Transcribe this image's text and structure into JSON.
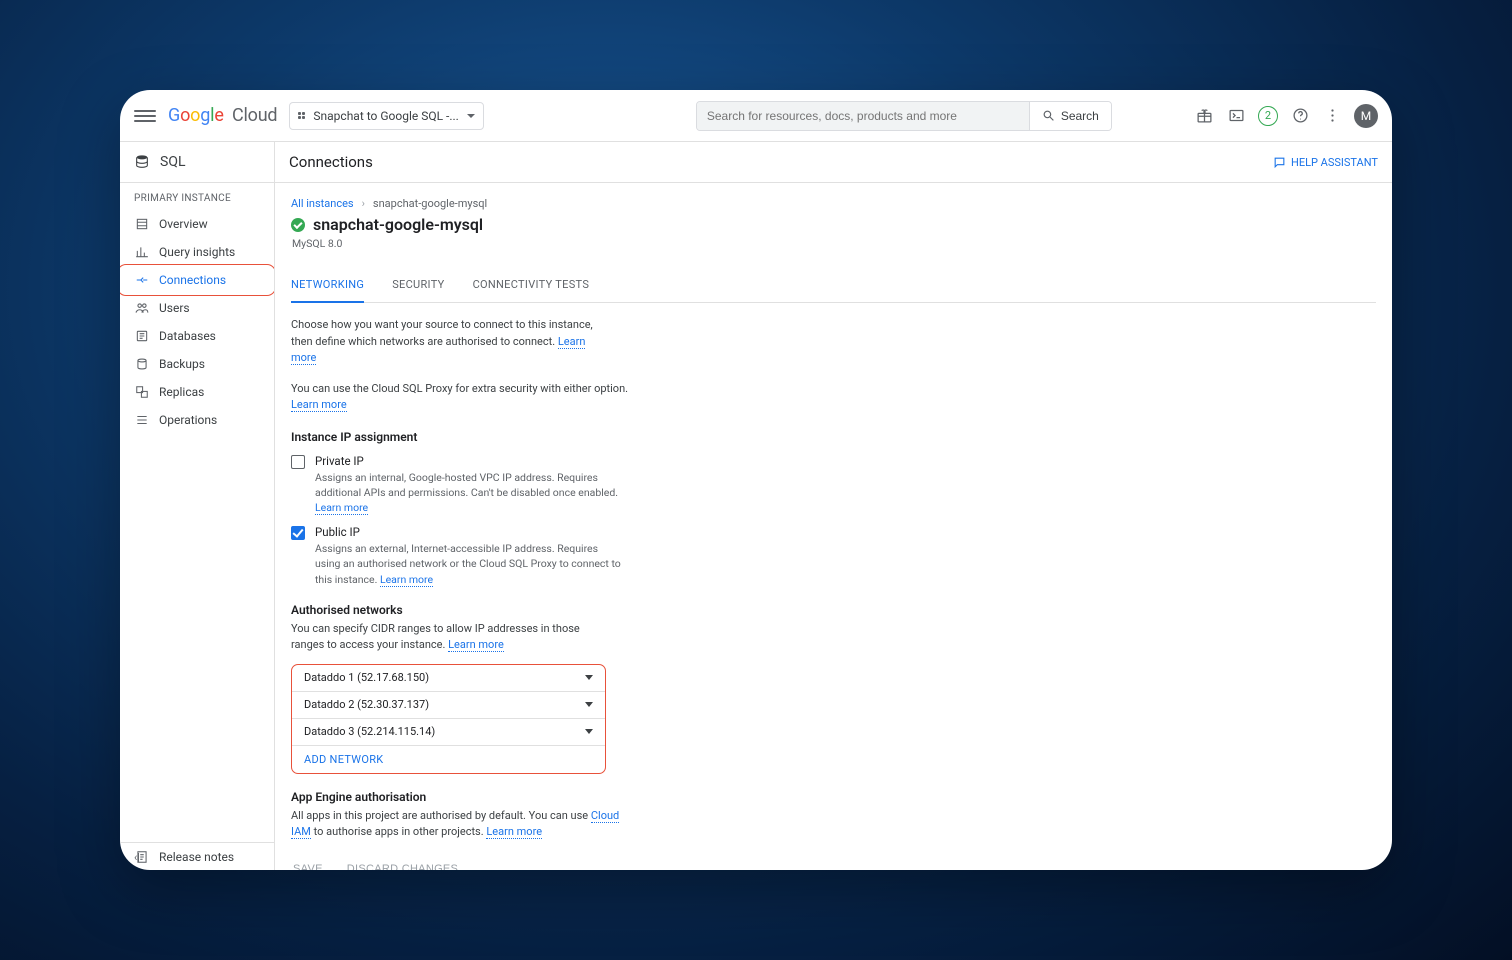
{
  "header": {
    "logo_cloud": "Cloud",
    "project_name": "Snapchat to Google SQL -...",
    "search_placeholder": "Search for resources, docs, products and more",
    "search_button": "Search",
    "notification_count": "2",
    "avatar_initial": "M"
  },
  "subheader": {
    "product": "SQL",
    "page_title": "Connections",
    "help_assistant": "HELP ASSISTANT"
  },
  "sidebar": {
    "section_label": "PRIMARY INSTANCE",
    "items": [
      {
        "label": "Overview"
      },
      {
        "label": "Query insights"
      },
      {
        "label": "Connections"
      },
      {
        "label": "Users"
      },
      {
        "label": "Databases"
      },
      {
        "label": "Backups"
      },
      {
        "label": "Replicas"
      },
      {
        "label": "Operations"
      }
    ],
    "release_notes": "Release notes"
  },
  "crumbs": {
    "root": "All instances",
    "leaf": "snapchat-google-mysql"
  },
  "instance": {
    "name": "snapchat-google-mysql",
    "version": "MySQL 8.0"
  },
  "tabs": [
    {
      "label": "NETWORKING"
    },
    {
      "label": "SECURITY"
    },
    {
      "label": "CONNECTIVITY TESTS"
    }
  ],
  "networking": {
    "intro1": "Choose how you want your source to connect to this instance, then define which networks are authorised to connect.",
    "intro2": "You can use the Cloud SQL Proxy for extra security with either option.",
    "learn_more": "Learn more",
    "ip_heading": "Instance IP assignment",
    "private": {
      "label": "Private IP",
      "desc": "Assigns an internal, Google-hosted VPC IP address. Requires additional APIs and permissions. Can't be disabled once enabled."
    },
    "public": {
      "label": "Public IP",
      "desc": "Assigns an external, Internet-accessible IP address. Requires using an authorised network or the Cloud SQL Proxy to connect to this instance."
    },
    "authnet_heading": "Authorised networks",
    "authnet_desc": "You can specify CIDR ranges to allow IP addresses in those ranges to access your instance.",
    "networks": [
      "Dataddo 1 (52.17.68.150)",
      "Dataddo 2 (52.30.37.137)",
      "Dataddo 3 (52.214.115.14)"
    ],
    "add_network": "ADD NETWORK",
    "appengine_heading": "App Engine authorisation",
    "appengine_desc_1": "All apps in this project are authorised by default. You can use ",
    "appengine_cloud_iam": "Cloud IAM",
    "appengine_desc_2": " to authorise apps in other projects.",
    "save": "SAVE",
    "discard": "DISCARD CHANGES"
  }
}
